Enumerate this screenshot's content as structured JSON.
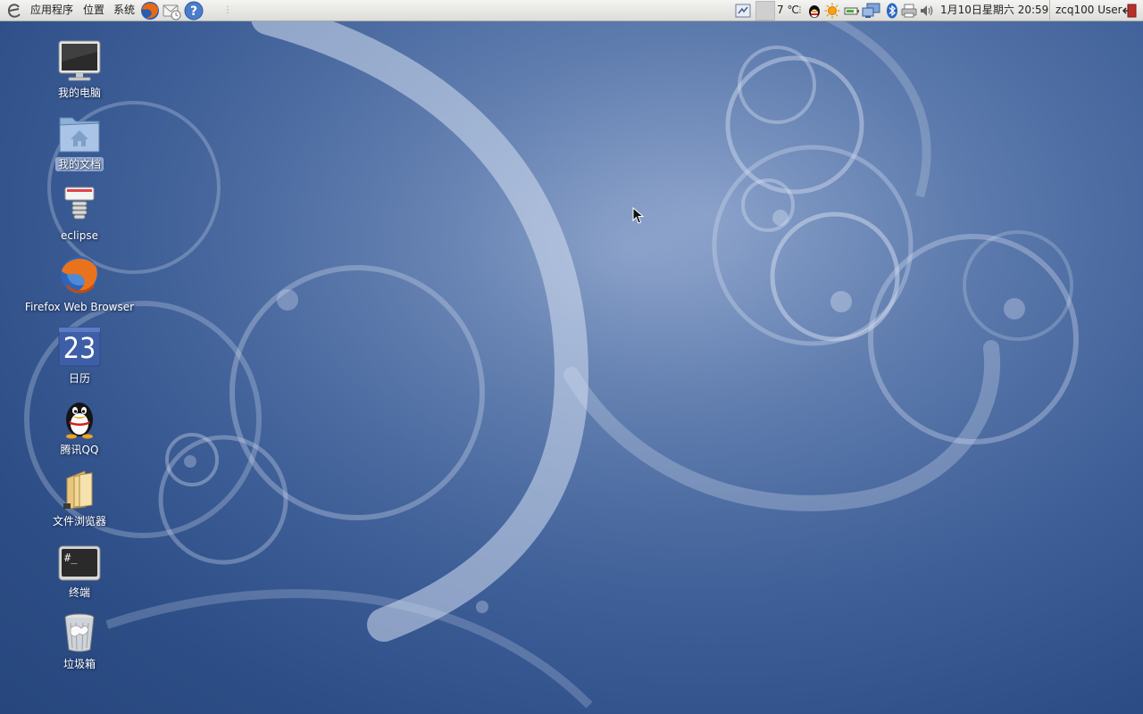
{
  "top_panel": {
    "menus": [
      "应用程序",
      "位置",
      "系统"
    ],
    "temperature": "7 ℃",
    "datetime": "1月10日星期六 20:59",
    "user": "zcq100 User",
    "launchers": [
      "firefox-icon",
      "mail-icon",
      "help-icon"
    ],
    "tray_icons": [
      "network-switch-icon",
      "blank-applet-icon",
      "qq-tray-icon",
      "weather-sun-icon",
      "battery-icon",
      "network-monitor-icon",
      "bluetooth-icon",
      "printer-icon",
      "volume-icon",
      "logout-icon"
    ]
  },
  "desktop": {
    "icons": [
      {
        "label": "我的电脑",
        "icon": "computer-icon"
      },
      {
        "label": "我的文档",
        "icon": "home-folder-icon",
        "selected": true
      },
      {
        "label": "eclipse",
        "icon": "eclipse-icon"
      },
      {
        "label": "Firefox Web Browser",
        "icon": "firefox-icon"
      },
      {
        "label": "日历",
        "icon": "calendar-icon",
        "day": "23"
      },
      {
        "label": "腾讯QQ",
        "icon": "qq-penguin-icon"
      },
      {
        "label": "文件浏览器",
        "icon": "file-browser-icon"
      },
      {
        "label": "终端",
        "icon": "terminal-icon",
        "prompt": "#_"
      },
      {
        "label": "垃圾箱",
        "icon": "trash-icon"
      }
    ]
  },
  "colors": {
    "wallpaper_base": "#3e5f98",
    "panel_bg": "#e8e8e4"
  }
}
